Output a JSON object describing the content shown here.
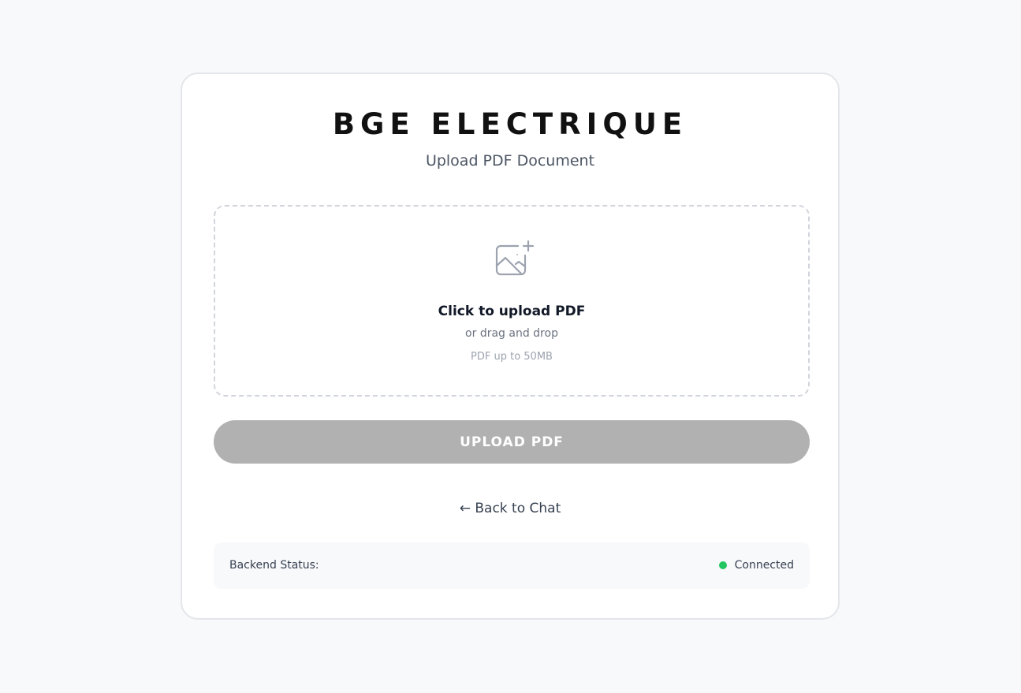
{
  "header": {
    "title": "BGE ELECTRIQUE",
    "subtitle": "Upload PDF Document"
  },
  "dropzone": {
    "icon": "image-plus-icon",
    "main_text": "Click to upload PDF",
    "sub_text": "or drag and drop",
    "limit_text": "PDF up to 50MB"
  },
  "upload_button": {
    "label": "UPLOAD PDF",
    "color": "#b1b1b1"
  },
  "back_link": {
    "label": "← Back to Chat"
  },
  "status": {
    "label": "Backend Status:",
    "value": "Connected",
    "indicator_color": "#22c55e"
  }
}
